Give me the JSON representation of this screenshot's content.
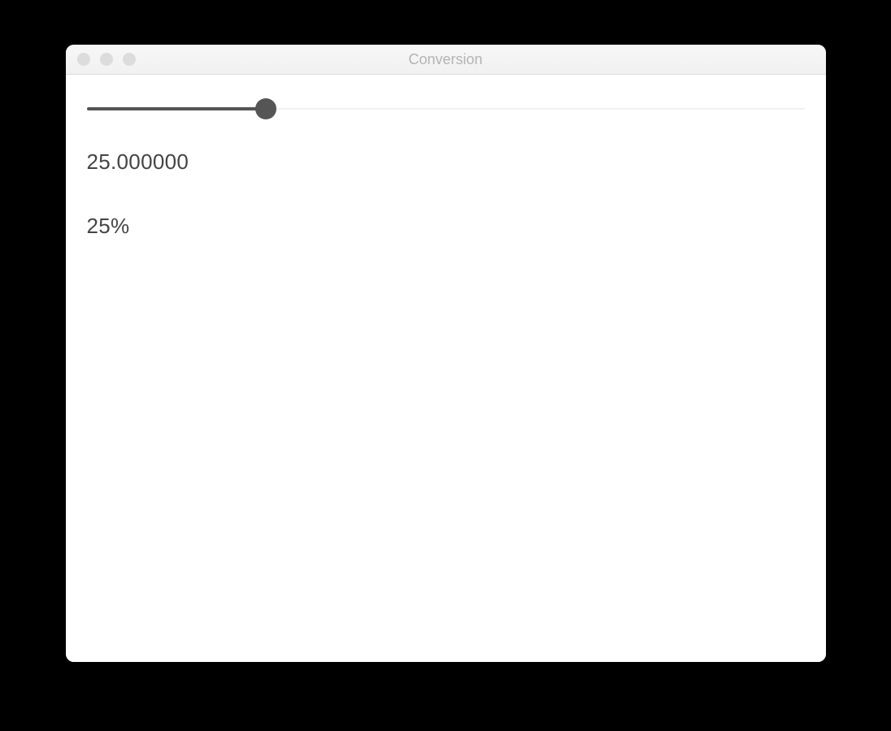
{
  "window": {
    "title": "Conversion"
  },
  "slider": {
    "value": 25,
    "min": 0,
    "max": 100
  },
  "labels": {
    "decimal_value": "25.000000",
    "percent_value": "25%"
  }
}
